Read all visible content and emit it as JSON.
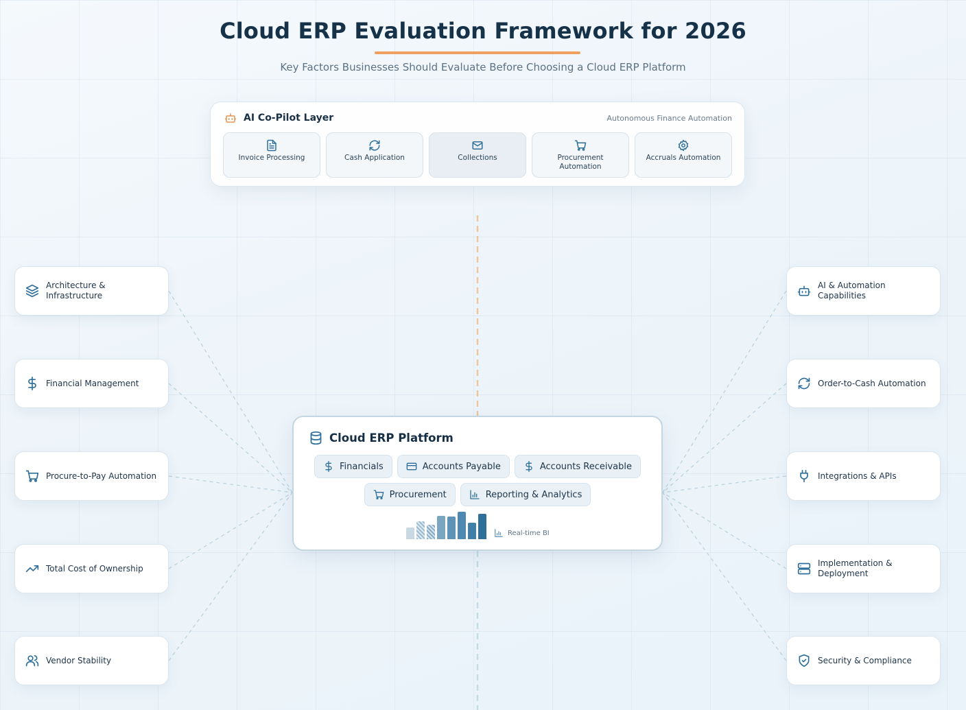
{
  "header": {
    "title": "Cloud ERP Evaluation Framework for 2026",
    "subtitle": "Key Factors Businesses Should Evaluate Before Choosing a Cloud ERP Platform"
  },
  "copilot": {
    "title": "AI Co-Pilot Layer",
    "tag": "Autonomous Finance Automation",
    "items": [
      {
        "label": "Invoice Processing",
        "icon": "document-icon"
      },
      {
        "label": "Cash Application",
        "icon": "refresh-icon"
      },
      {
        "label": "Collections",
        "icon": "mail-icon"
      },
      {
        "label": "Procurement Automation",
        "icon": "cart-icon"
      },
      {
        "label": "Accruals Automation",
        "icon": "gear-icon"
      }
    ]
  },
  "left_factors": [
    {
      "label": "Architecture & Infrastructure",
      "icon": "layers-icon"
    },
    {
      "label": "Financial Management",
      "icon": "dollar-icon"
    },
    {
      "label": "Procure-to-Pay Automation",
      "icon": "cart-icon"
    },
    {
      "label": "Total Cost of Ownership",
      "icon": "trending-up-icon"
    },
    {
      "label": "Vendor Stability",
      "icon": "users-icon"
    }
  ],
  "right_factors": [
    {
      "label": "AI & Automation Capabilities",
      "icon": "robot-icon"
    },
    {
      "label": "Order-to-Cash Automation",
      "icon": "refresh-icon"
    },
    {
      "label": "Integrations & APIs",
      "icon": "plug-icon"
    },
    {
      "label": "Implementation & Deployment",
      "icon": "server-icon"
    },
    {
      "label": "Security & Compliance",
      "icon": "shield-icon"
    }
  ],
  "platform": {
    "title": "Cloud ERP Platform",
    "modules_row1": [
      {
        "label": "Financials",
        "icon": "dollar-icon"
      },
      {
        "label": "Accounts Payable",
        "icon": "credit-card-icon"
      },
      {
        "label": "Accounts Receivable",
        "icon": "dollar-icon"
      }
    ],
    "modules_row2": [
      {
        "label": "Procurement",
        "icon": "cart-icon"
      },
      {
        "label": "Reporting & Analytics",
        "icon": "bar-chart-icon"
      }
    ],
    "bi_label": "Real-time BI",
    "bi_bars": [
      0.4,
      0.62,
      0.5,
      0.8,
      0.78,
      0.95,
      0.58,
      0.88
    ]
  },
  "colors": {
    "accent": "#ef9f5f",
    "icon": "#2d6f9a",
    "copilot_icon": "#e9934f",
    "connector": "#b9d3df",
    "vertical_top": "#eec89c",
    "vertical_bottom": "#c5dde5"
  }
}
